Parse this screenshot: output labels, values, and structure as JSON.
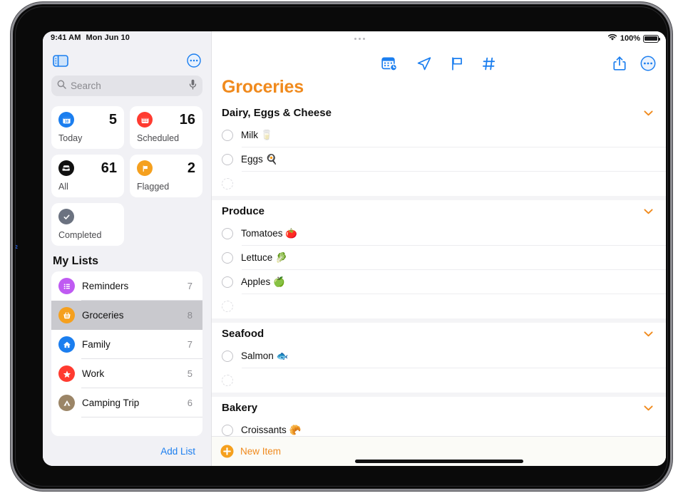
{
  "status_bar": {
    "time": "9:41 AM",
    "date": "Mon Jun 10",
    "battery_percent": "100%",
    "wifi_icon": "wifi-icon",
    "battery_icon": "battery-full-icon",
    "dots_icon": "status-dots-icon"
  },
  "sidebar": {
    "toggle_icon": "sidebar-toggle-icon",
    "more_icon": "more-circle-icon",
    "search": {
      "placeholder": "Search",
      "search_icon": "search-icon",
      "mic_icon": "microphone-icon"
    },
    "smart_lists": [
      {
        "name": "Today",
        "count": "5",
        "icon": "calendar-today-icon",
        "color": "#1b7eef"
      },
      {
        "name": "Scheduled",
        "count": "16",
        "icon": "calendar-icon",
        "color": "#ff3b30"
      },
      {
        "name": "All",
        "count": "61",
        "icon": "inbox-icon",
        "color": "#111111"
      },
      {
        "name": "Flagged",
        "count": "2",
        "icon": "flag-icon",
        "color": "#f5a01e"
      },
      {
        "name": "Completed",
        "count": "",
        "icon": "checkmark-icon",
        "color": "#6b7280"
      }
    ],
    "my_lists_header": "My Lists",
    "lists": [
      {
        "name": "Reminders",
        "count": "7",
        "icon": "list-bullet-icon",
        "color": "#bf5af2",
        "selected": false
      },
      {
        "name": "Groceries",
        "count": "8",
        "icon": "basket-icon",
        "color": "#f5a01e",
        "selected": true
      },
      {
        "name": "Family",
        "count": "7",
        "icon": "house-icon",
        "color": "#1b7eef",
        "selected": false
      },
      {
        "name": "Work",
        "count": "5",
        "icon": "star-icon",
        "color": "#ff3b30",
        "selected": false
      },
      {
        "name": "Camping Trip",
        "count": "6",
        "icon": "tent-icon",
        "color": "#9b8567",
        "selected": false
      }
    ],
    "add_list_label": "Add List"
  },
  "main": {
    "title": "Groceries",
    "title_color": "#f08a1d",
    "toolbar": {
      "center_icons": [
        {
          "name": "calendar-badge-icon"
        },
        {
          "name": "location-arrow-icon"
        },
        {
          "name": "flag-icon"
        },
        {
          "name": "hashtag-icon"
        }
      ],
      "right_icons": [
        {
          "name": "share-icon"
        },
        {
          "name": "more-circle-icon"
        }
      ]
    },
    "sections": [
      {
        "header": "Dairy, Eggs & Cheese",
        "chevron_icon": "chevron-down-icon",
        "items": [
          {
            "text": "Milk 🥛",
            "empty": false
          },
          {
            "text": "Eggs 🍳",
            "empty": false
          },
          {
            "text": "",
            "empty": true
          }
        ]
      },
      {
        "header": "Produce",
        "chevron_icon": "chevron-down-icon",
        "items": [
          {
            "text": "Tomatoes 🍅",
            "empty": false
          },
          {
            "text": "Lettuce 🥬",
            "empty": false
          },
          {
            "text": "Apples 🍏",
            "empty": false
          },
          {
            "text": "",
            "empty": true
          }
        ]
      },
      {
        "header": "Seafood",
        "chevron_icon": "chevron-down-icon",
        "items": [
          {
            "text": "Salmon 🐟",
            "empty": false
          },
          {
            "text": "",
            "empty": true
          }
        ]
      },
      {
        "header": "Bakery",
        "chevron_icon": "chevron-down-icon",
        "items": [
          {
            "text": "Croissants 🥐",
            "empty": false
          }
        ]
      }
    ],
    "new_item_label": "New Item",
    "plus_icon": "plus-circle-icon"
  },
  "device": {
    "bezel_marker": "2",
    "home_indicator": "home-indicator"
  }
}
